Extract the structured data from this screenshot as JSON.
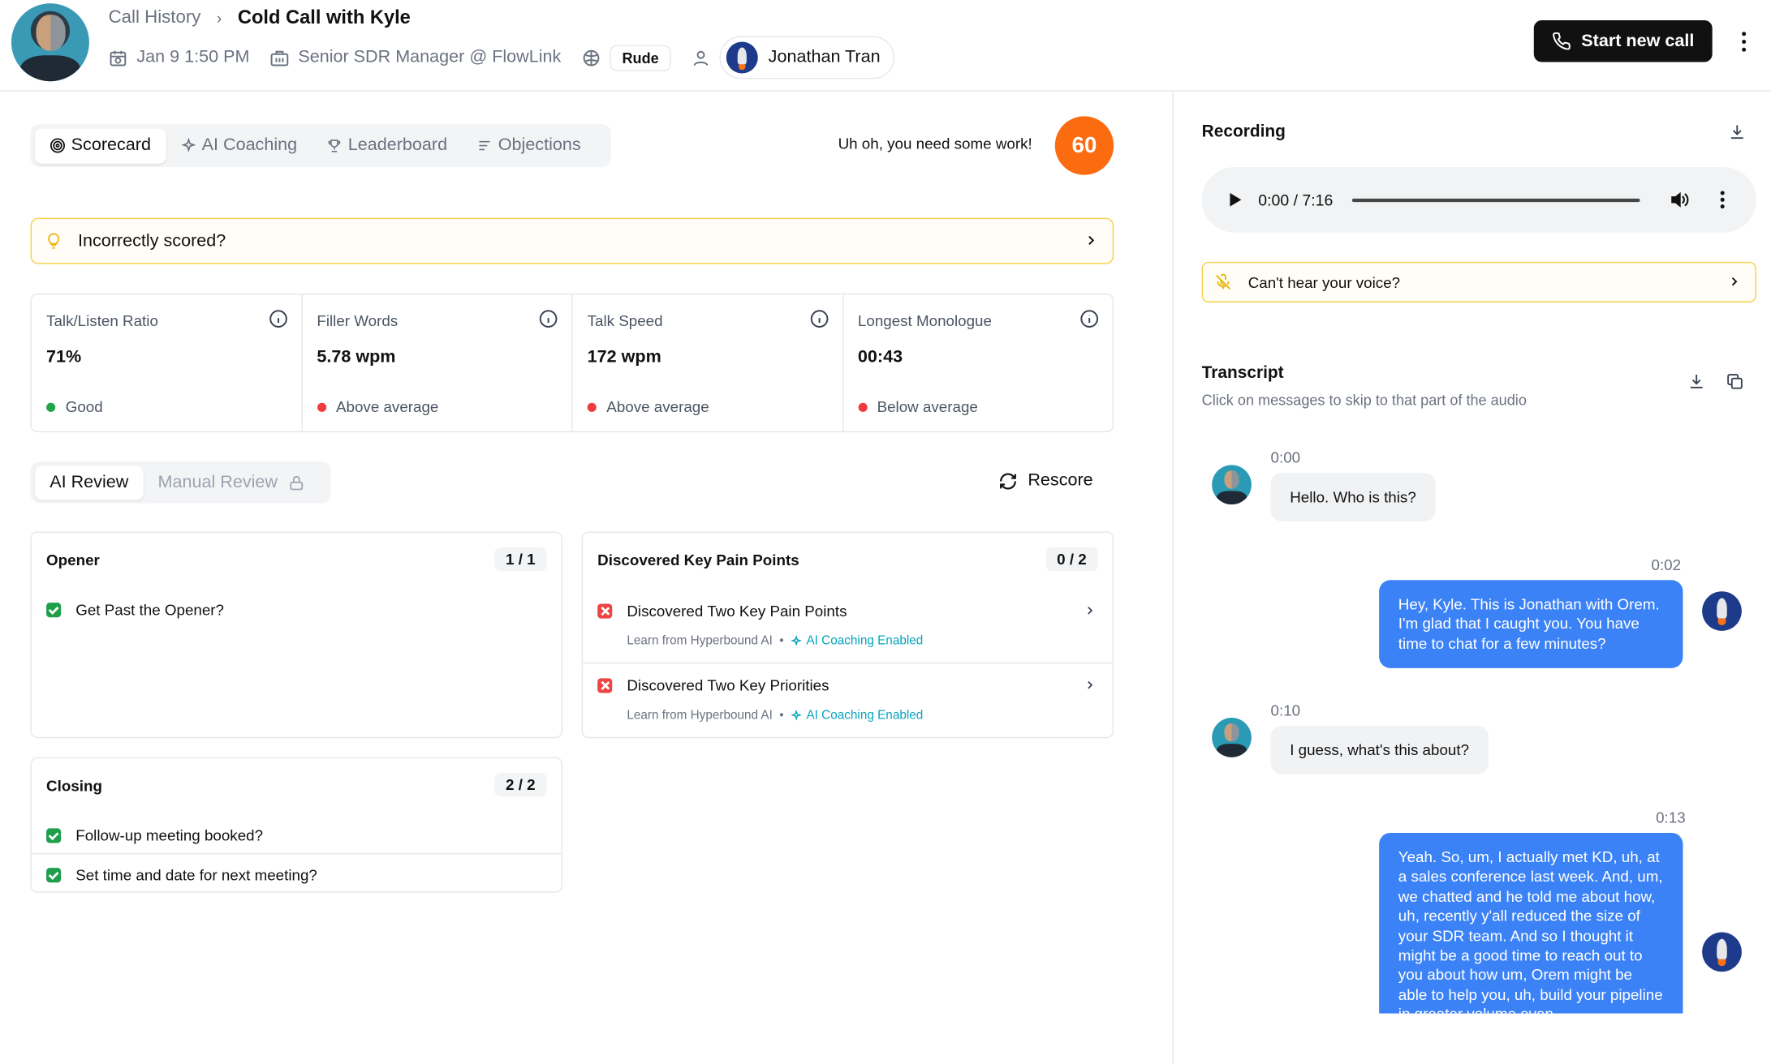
{
  "header": {
    "breadcrumb": "Call History",
    "title": "Cold Call with Kyle",
    "date": "Jan 9 1:50 PM",
    "role": "Senior SDR Manager @ FlowLink",
    "mood_badge": "Rude",
    "user_name": "Jonathan Tran",
    "start_button": "Start new call"
  },
  "tabs": [
    {
      "label": "Scorecard",
      "icon": "target-icon",
      "active": true
    },
    {
      "label": "AI Coaching",
      "icon": "sparkle-icon",
      "active": false
    },
    {
      "label": "Leaderboard",
      "icon": "trophy-icon",
      "active": false
    },
    {
      "label": "Objections",
      "icon": "list-icon",
      "active": false
    }
  ],
  "score": {
    "message": "Uh oh, you need some work!",
    "value": "60",
    "color": "#fb6b10"
  },
  "incorrect_bar": {
    "label": "Incorrectly scored?"
  },
  "metrics": [
    {
      "label": "Talk/Listen Ratio",
      "value": "71%",
      "status": "Good",
      "status_color": "#22a447"
    },
    {
      "label": "Filler Words",
      "value": "5.78 wpm",
      "status": "Above average",
      "status_color": "#ef3b3b"
    },
    {
      "label": "Talk Speed",
      "value": "172 wpm",
      "status": "Above average",
      "status_color": "#ef3b3b"
    },
    {
      "label": "Longest Monologue",
      "value": "00:43",
      "status": "Below average",
      "status_color": "#ef3b3b"
    }
  ],
  "review_tabs": {
    "ai": "AI Review",
    "manual": "Manual Review",
    "rescore": "Rescore"
  },
  "cards": {
    "opener": {
      "title": "Opener",
      "count": "1 / 1",
      "items": [
        "Get Past the Opener?"
      ]
    },
    "pain_points": {
      "title": "Discovered Key Pain Points",
      "count": "0 / 2",
      "items": [
        {
          "label": "Discovered Two Key Pain Points",
          "sub": "Learn from Hyperbound AI",
          "coaching": "AI Coaching Enabled"
        },
        {
          "label": "Discovered Two Key Priorities",
          "sub": "Learn from Hyperbound AI",
          "coaching": "AI Coaching Enabled"
        }
      ]
    },
    "closing": {
      "title": "Closing",
      "count": "2 / 2",
      "items": [
        "Follow-up meeting booked?",
        "Set time and date for next meeting?"
      ]
    }
  },
  "recording": {
    "title": "Recording",
    "time": "0:00 / 7:16",
    "hear_label": "Can't hear your voice?"
  },
  "transcript": {
    "title": "Transcript",
    "subtitle": "Click on messages to skip to that part of the audio",
    "messages": [
      {
        "time": "0:00",
        "speaker": "kyle",
        "text": "Hello. Who is this?"
      },
      {
        "time": "0:02",
        "speaker": "me",
        "text": "Hey, Kyle. This is Jonathan with Orem. I'm glad that I caught you. You have time to chat for a few minutes?"
      },
      {
        "time": "0:10",
        "speaker": "kyle",
        "text": "I guess, what's this about?"
      },
      {
        "time": "0:13",
        "speaker": "me",
        "text": "Yeah. So, um, I actually met KD, uh, at a sales conference last week. And, um, we chatted and he told me about how, uh, recently y'all reduced the size of your SDR team. And so I thought it might be a good time to reach out to you about how um, Orem might be able to help you, uh, build your pipeline in greater volume even"
      }
    ]
  }
}
